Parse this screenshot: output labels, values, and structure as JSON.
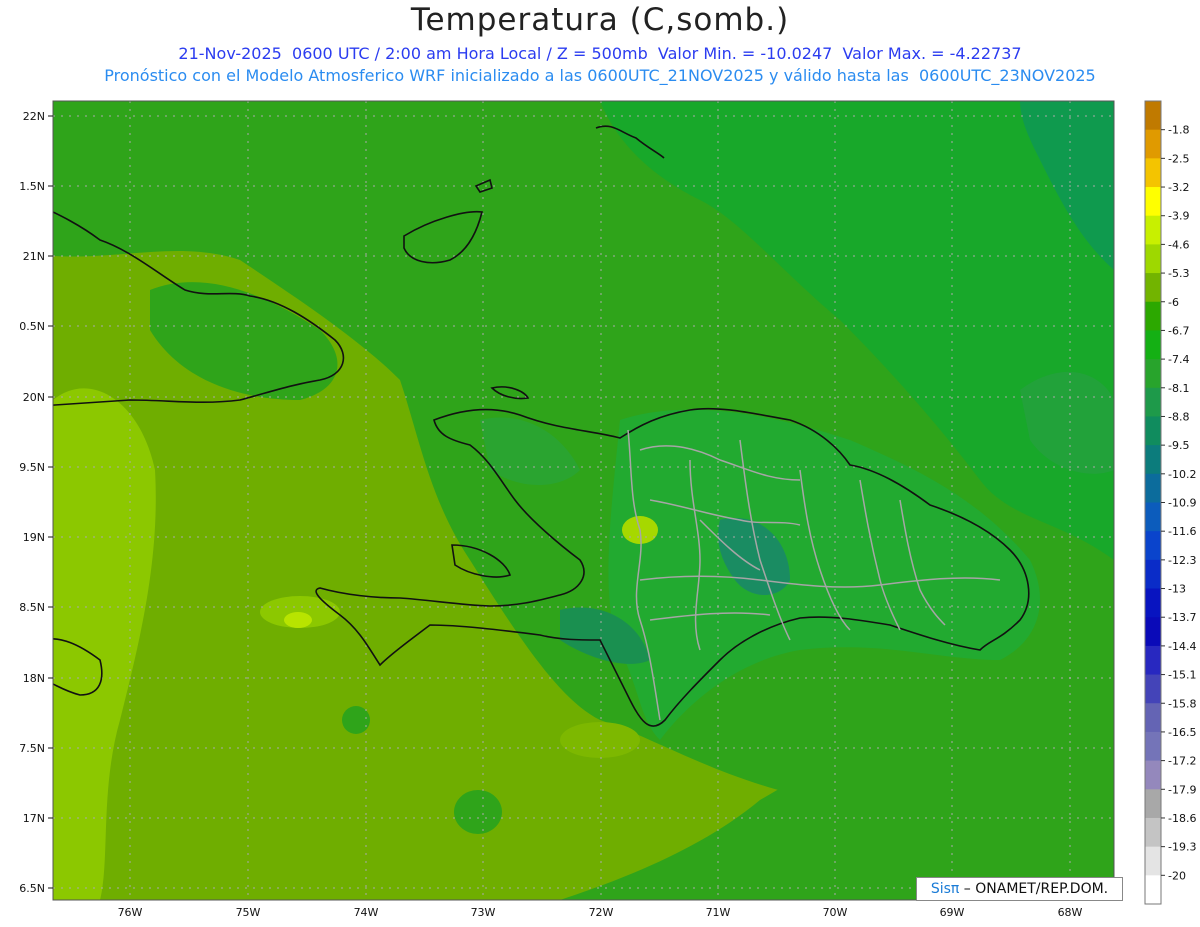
{
  "title": "Temperatura (C,somb.)",
  "subtitle_line1": "21-Nov-2025  0600 UTC / 2:00 am Hora Local / Z = 500mb  Valor Min. = -10.0247  Valor Max. = -4.22737",
  "subtitle_line2": "Pronóstico con el Modelo Atmosferico WRF inicializado a las 0600UTC_21NOV2025 y válido hasta las  0600UTC_23NOV2025",
  "lat_labels": [
    "22N",
    "1.5N",
    "21N",
    "0.5N",
    "20N",
    "9.5N",
    "19N",
    "8.5N",
    "18N",
    "7.5N",
    "17N",
    "6.5N"
  ],
  "lon_labels": [
    "76W",
    "75W",
    "74W",
    "73W",
    "72W",
    "71W",
    "70W",
    "69W",
    "68W"
  ],
  "colorbar": {
    "labels": [
      "-1.8",
      "-2.5",
      "-3.2",
      "-3.9",
      "-4.6",
      "-5.3",
      "-6",
      "-6.7",
      "-7.4",
      "-8.1",
      "-8.8",
      "-9.5",
      "-10.2",
      "-10.9",
      "-11.6",
      "-12.3",
      "-13",
      "-13.7",
      "-14.4",
      "-15.1",
      "-15.8",
      "-16.5",
      "-17.2",
      "-17.9",
      "-18.6",
      "-19.3",
      "-20"
    ],
    "colors": [
      "#c07a00",
      "#e09a00",
      "#f4c400",
      "#ffff00",
      "#c8f000",
      "#9ed800",
      "#72b400",
      "#2ca800",
      "#14b014",
      "#28a42c",
      "#1e9a4a",
      "#108c5e",
      "#0c7c7c",
      "#0c6c9c",
      "#0c5cbc",
      "#0a44cc",
      "#0a2cc8",
      "#0814c0",
      "#0a0ab8",
      "#2828c0",
      "#4444b8",
      "#6464b4",
      "#7474b8",
      "#9488bc",
      "#a8a8a8",
      "#c4c4c4",
      "#e4e4e4",
      "#ffffff"
    ]
  },
  "credit": {
    "logo": "Sisπ",
    "text": " – ONAMET/REP.DOM."
  }
}
